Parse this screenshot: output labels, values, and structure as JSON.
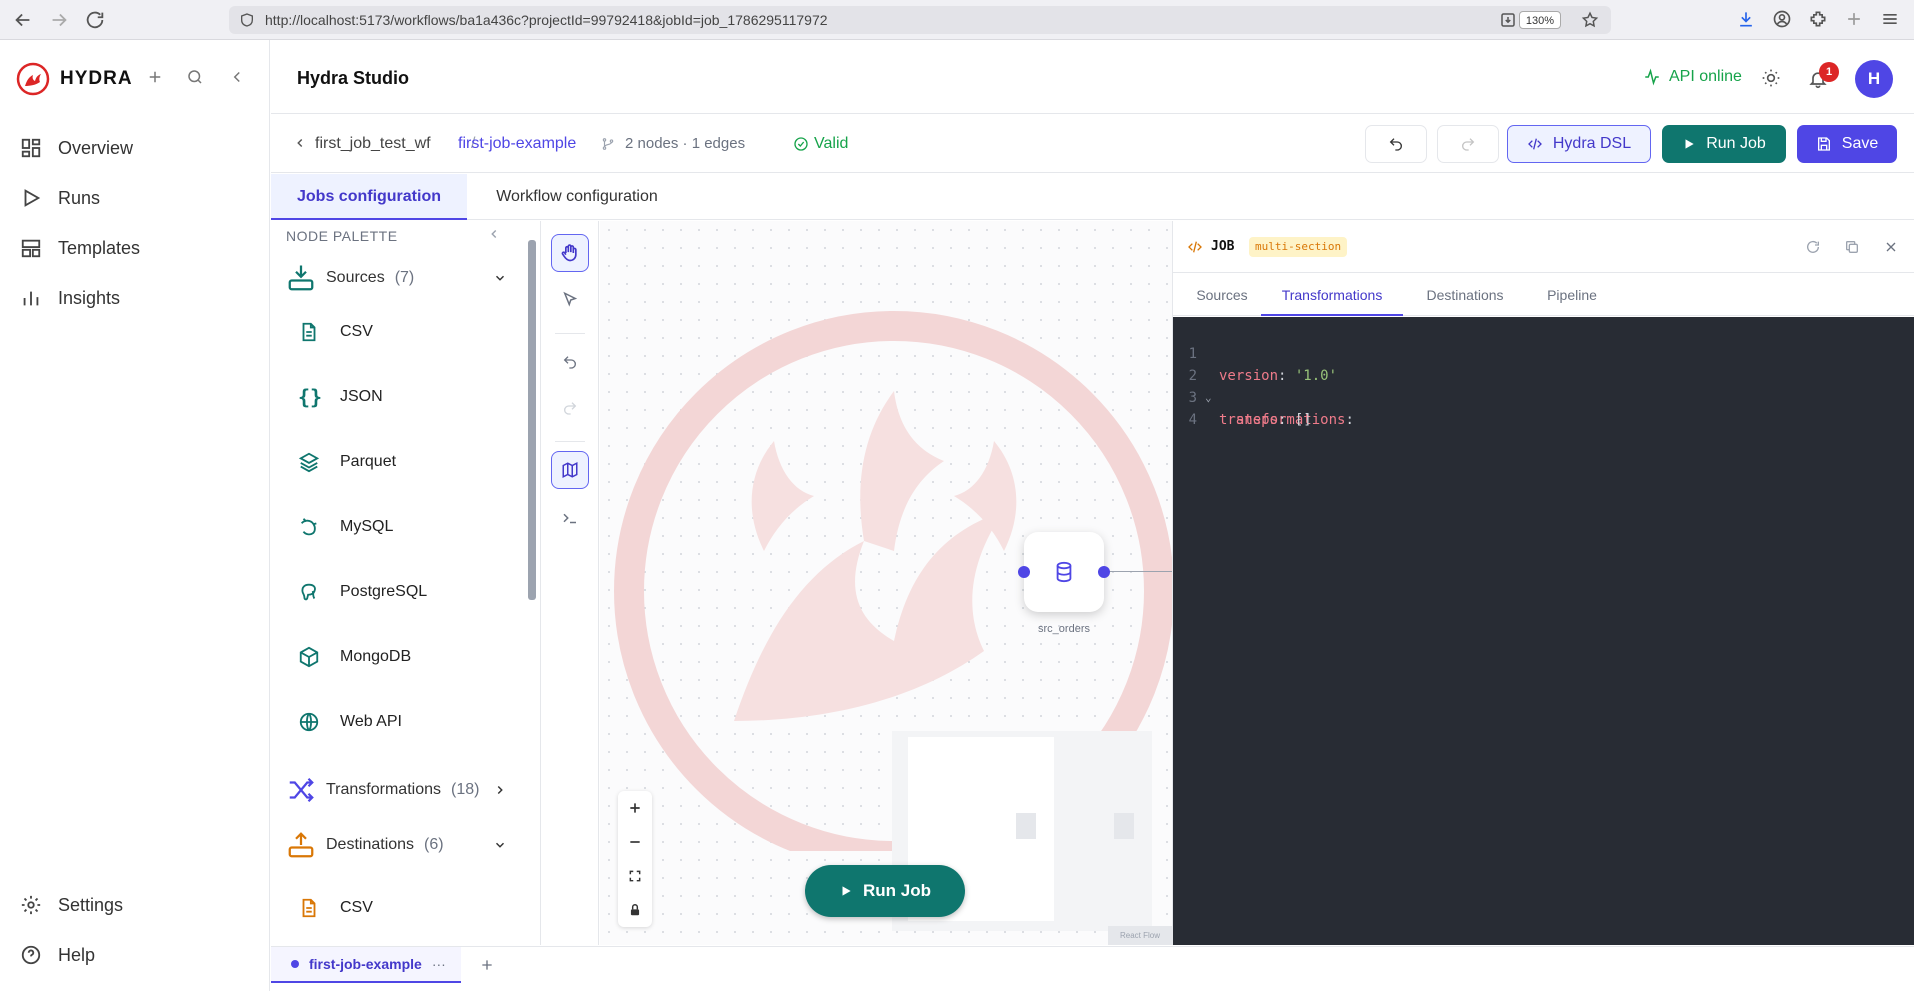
{
  "browser": {
    "url": "http://localhost:5173/workflows/ba1a436c?projectId=99792418&jobId=job_1786295117972",
    "zoom": "130%"
  },
  "sidebar": {
    "logo": "HYDRA",
    "items": [
      {
        "label": "Overview",
        "icon": "grid-icon"
      },
      {
        "label": "Runs",
        "icon": "play-icon"
      },
      {
        "label": "Templates",
        "icon": "layout-icon"
      },
      {
        "label": "Insights",
        "icon": "bar-chart-icon"
      }
    ],
    "bottom": [
      {
        "label": "Settings",
        "icon": "gear-icon"
      },
      {
        "label": "Help",
        "icon": "help-icon"
      }
    ]
  },
  "header": {
    "title": "Hydra Studio",
    "api_status": "API online",
    "notifications": "1",
    "avatar": "H"
  },
  "toolbar": {
    "workflow": "first_job_test_wf",
    "separator": "/",
    "job": "first-job-example",
    "stats": "2 nodes · 1 edges",
    "status": "Valid",
    "dsl_label": "Hydra DSL",
    "run_label": "Run Job",
    "save_label": "Save"
  },
  "main_tabs": [
    {
      "label": "Jobs configuration",
      "active": true
    },
    {
      "label": "Workflow configuration",
      "active": false
    }
  ],
  "palette": {
    "title": "NODE PALETTE",
    "sources": {
      "label": "Sources",
      "count": "(7)",
      "items": [
        "CSV",
        "JSON",
        "Parquet",
        "MySQL",
        "PostgreSQL",
        "MongoDB",
        "Web API"
      ]
    },
    "transformations": {
      "label": "Transformations",
      "count": "(18)"
    },
    "destinations": {
      "label": "Destinations",
      "count": "(6)",
      "items": [
        "CSV"
      ]
    }
  },
  "canvas": {
    "node_label": "src_orders",
    "run_label": "Run Job",
    "watermark": "React Flow"
  },
  "editor": {
    "title": "JOB",
    "badge": "multi-section",
    "tabs": [
      {
        "label": "Sources",
        "active": false
      },
      {
        "label": "Transformations",
        "active": true
      },
      {
        "label": "Destinations",
        "active": false
      },
      {
        "label": "Pipeline",
        "active": false
      }
    ],
    "lines": [
      {
        "n": "1",
        "key": "version",
        "value": "'1.0'"
      },
      {
        "n": "2",
        "key": "transformations",
        "value": ""
      },
      {
        "n": "3",
        "key": "  steps",
        "value": "[]"
      },
      {
        "n": "4",
        "key": "",
        "value": ""
      }
    ]
  },
  "bottom_tab": {
    "label": "first-job-example",
    "menu": "···"
  },
  "colors": {
    "accent": "#4f46e5",
    "success": "#0f766e",
    "brand": "#dc2626"
  }
}
